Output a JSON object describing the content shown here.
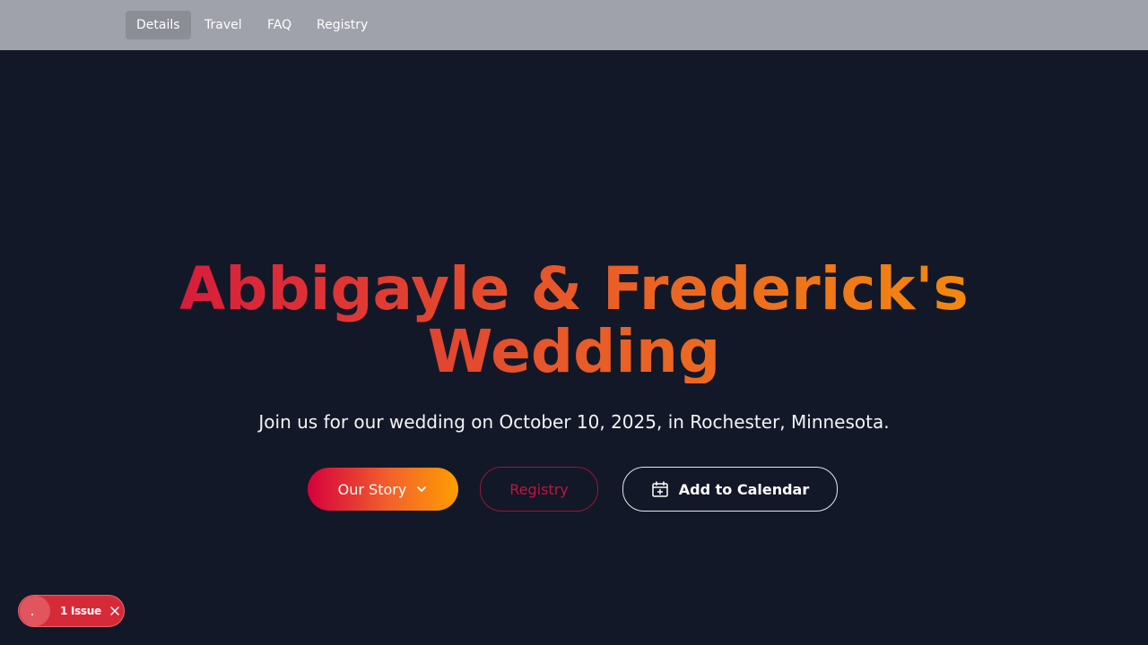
{
  "nav": {
    "items": [
      {
        "label": "Details",
        "active": true
      },
      {
        "label": "Travel",
        "active": false
      },
      {
        "label": "FAQ",
        "active": false
      },
      {
        "label": "Registry",
        "active": false
      }
    ]
  },
  "hero": {
    "title_line1": "Abbigayle & Frederick's",
    "title_line2": "Wedding",
    "subtitle": "Join us for our wedding on October 10, 2025, in Rochester, Minnesota."
  },
  "buttons": {
    "story_label": "Our Story",
    "story_icon": "chevron-down-icon",
    "registry_label": "Registry",
    "calendar_label": "Add to Calendar",
    "calendar_icon": "calendar-plus-icon"
  },
  "issues": {
    "label": "1 Issue",
    "close_icon": "close-icon"
  },
  "colors": {
    "background": "#121827",
    "nav_background": "#9fa2aa",
    "accent_red": "#d6003c",
    "accent_orange": "#ff9e00",
    "issue_red": "#d72a39"
  }
}
